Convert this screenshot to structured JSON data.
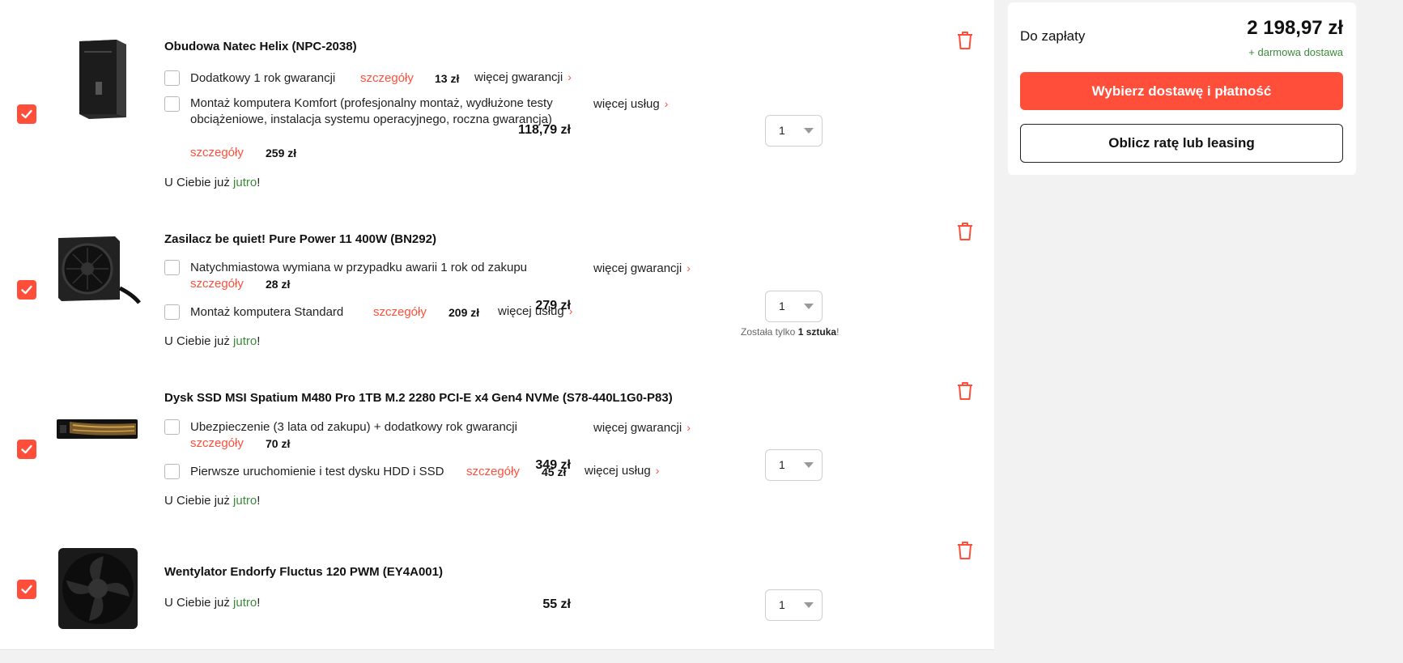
{
  "summary": {
    "to_pay_label": "Do zapłaty",
    "total": "2 198,97 zł",
    "free_delivery": "+ darmowa dostawa",
    "choose_delivery_button": "Wybierz dostawę i płatność",
    "installment_button": "Oblicz ratę lub leasing"
  },
  "common": {
    "details": "szczegóły",
    "more_warranty": "więcej gwarancji",
    "more_services": "więcej usług",
    "delivery_prefix": "U Ciebie już ",
    "delivery_day": "jutro",
    "delivery_suffix": "!",
    "chevron": "›"
  },
  "items": [
    {
      "title": "Obudowa Natec Helix (NPC-2038)",
      "quantity": "1",
      "price": "118,79 zł",
      "checked": true,
      "options": [
        {
          "label": "Dodatkowy 1 rok gwarancji",
          "price": "13 zł"
        },
        {
          "label": "Montaż komputera Komfort (profesjonalny montaż, wydłużone testy obciążeniowe, instalacja systemu operacyjnego, roczna gwarancja)",
          "price": "259 zł"
        }
      ]
    },
    {
      "title": "Zasilacz be quiet! Pure Power 11 400W (BN292)",
      "quantity": "1",
      "price": "279 zł",
      "checked": true,
      "stock_prefix": "Została tylko ",
      "stock_count": "1 sztuka",
      "stock_suffix": "!",
      "options": [
        {
          "label": "Natychmiastowa wymiana w przypadku awarii 1 rok od zakupu",
          "price": "28 zł"
        },
        {
          "label": "Montaż komputera Standard",
          "price": "209 zł"
        }
      ]
    },
    {
      "title": "Dysk SSD MSI Spatium M480 Pro 1TB M.2 2280 PCI-E x4 Gen4 NVMe (S78-440L1G0-P83)",
      "quantity": "1",
      "price": "349 zł",
      "checked": true,
      "options": [
        {
          "label": "Ubezpieczenie (3 lata od zakupu) + dodatkowy rok gwarancji",
          "price": "70 zł"
        },
        {
          "label": "Pierwsze uruchomienie i test dysku HDD i SSD",
          "price": "45 zł"
        }
      ]
    },
    {
      "title": "Wentylator Endorfy Fluctus 120 PWM (EY4A001)",
      "quantity": "1",
      "price": "55 zł",
      "checked": true,
      "options": []
    }
  ],
  "colors": {
    "accent": "#ff4f3b",
    "green": "#3a8a3a",
    "background": "#f2f2f2"
  },
  "icons": [
    "checkmark-icon",
    "trash-icon",
    "chevron-right-icon",
    "dropdown-arrow-icon"
  ]
}
